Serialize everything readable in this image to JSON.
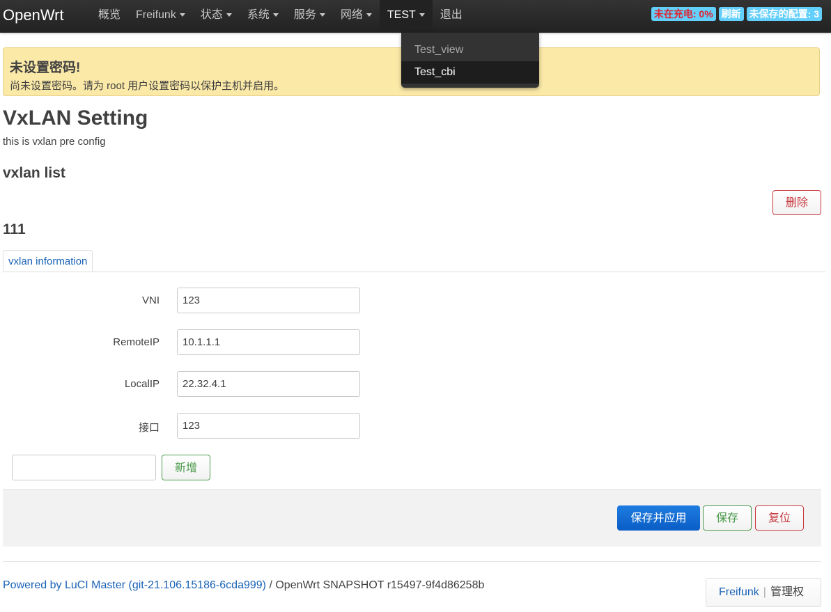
{
  "header": {
    "brand": "OpenWrt",
    "nav": [
      {
        "label": "概览",
        "has_caret": false
      },
      {
        "label": "Freifunk",
        "has_caret": true
      },
      {
        "label": "状态",
        "has_caret": true
      },
      {
        "label": "系统",
        "has_caret": true
      },
      {
        "label": "服务",
        "has_caret": true
      },
      {
        "label": "网络",
        "has_caret": true
      },
      {
        "label": "TEST",
        "has_caret": true
      },
      {
        "label": "退出",
        "has_caret": false
      }
    ],
    "indicators": {
      "charging": "未在充电: 0%",
      "refresh": "刷新",
      "unsaved": "未保存的配置: 3"
    }
  },
  "dropdown": {
    "items": [
      "Test_view",
      "Test_cbi"
    ]
  },
  "alert": {
    "title": "未设置密码!",
    "text": "尚未设置密码。请为 root 用户设置密码以保护主机并启用。"
  },
  "page": {
    "title": "VxLAN Setting",
    "description": "this is vxlan pre config",
    "section_title": "vxlan list",
    "remove_label": "删除",
    "section_name": "111",
    "tab_label": "vxlan information"
  },
  "form": {
    "fields": [
      {
        "label": "VNI",
        "value": "123"
      },
      {
        "label": "RemoteIP",
        "value": "10.1.1.1"
      },
      {
        "label": "LocalIP",
        "value": "22.32.4.1"
      },
      {
        "label": "接口",
        "value": "123"
      }
    ],
    "new_section_value": "",
    "add_label": "新增"
  },
  "actions": {
    "save_apply": "保存并应用",
    "save": "保存",
    "reset": "复位"
  },
  "footer": {
    "powered_by": "Powered by LuCI Master (git-21.106.15186-6cda999)",
    "separator": " / ",
    "version": "OpenWrt SNAPSHOT r15497-9f4d86258b",
    "link_freifunk": "Freifunk",
    "link_admin": "管理权"
  },
  "colors": {
    "topbar": "#333333",
    "indicator_bg": "#62cffc",
    "alert_bg": "#fbe9a8",
    "primary": "#0a5dc6",
    "positive": "#4a9a4a",
    "negative": "#c7383d",
    "link": "#1a62b6"
  }
}
